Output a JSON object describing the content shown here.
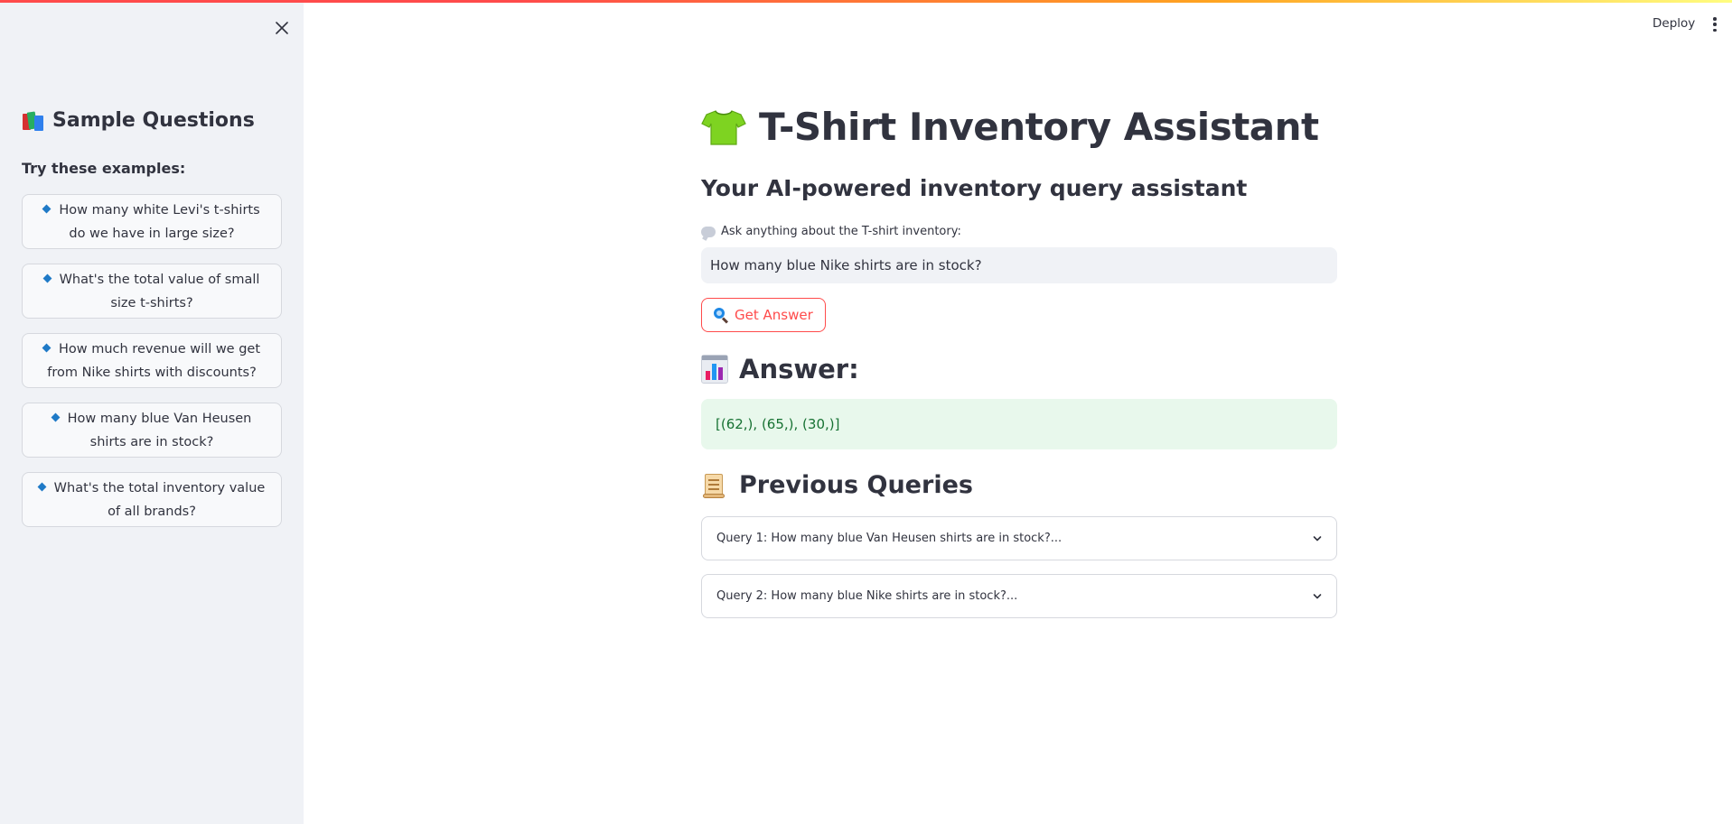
{
  "sidebar": {
    "title": "Sample Questions",
    "title_icon": "books-icon",
    "subtitle": "Try these examples:",
    "samples": [
      {
        "label": "How many white Levi's t-shirts do we have in large size?"
      },
      {
        "label": "What's the total value of small size t-shirts?"
      },
      {
        "label": "How much revenue will we get from Nike shirts with discounts?"
      },
      {
        "label": "How many blue Van Heusen shirts are in stock?"
      },
      {
        "label": "What's the total inventory value of all brands?"
      }
    ]
  },
  "header": {
    "deploy_label": "Deploy"
  },
  "main": {
    "title": "T-Shirt Inventory Assistant",
    "title_icon": "tshirt-icon",
    "subtitle": "Your AI-powered inventory query assistant",
    "input_label": "Ask anything about the T-shirt inventory:",
    "input_value": "How many blue Nike shirts are in stock?",
    "button_label": "Get Answer",
    "answer_heading": "Answer:",
    "answer_text": "[(62,), (65,), (30,)]",
    "previous_heading": "Previous Queries",
    "previous_queries": [
      {
        "label": "Query 1: How many blue Van Heusen shirts are in stock?..."
      },
      {
        "label": "Query 2: How many blue Nike shirts are in stock?..."
      }
    ]
  },
  "colors": {
    "accent": "#ff4b4b",
    "sidebar_bg": "#f0f2f6",
    "success_bg": "#e8f8ec",
    "success_text": "#177233"
  }
}
